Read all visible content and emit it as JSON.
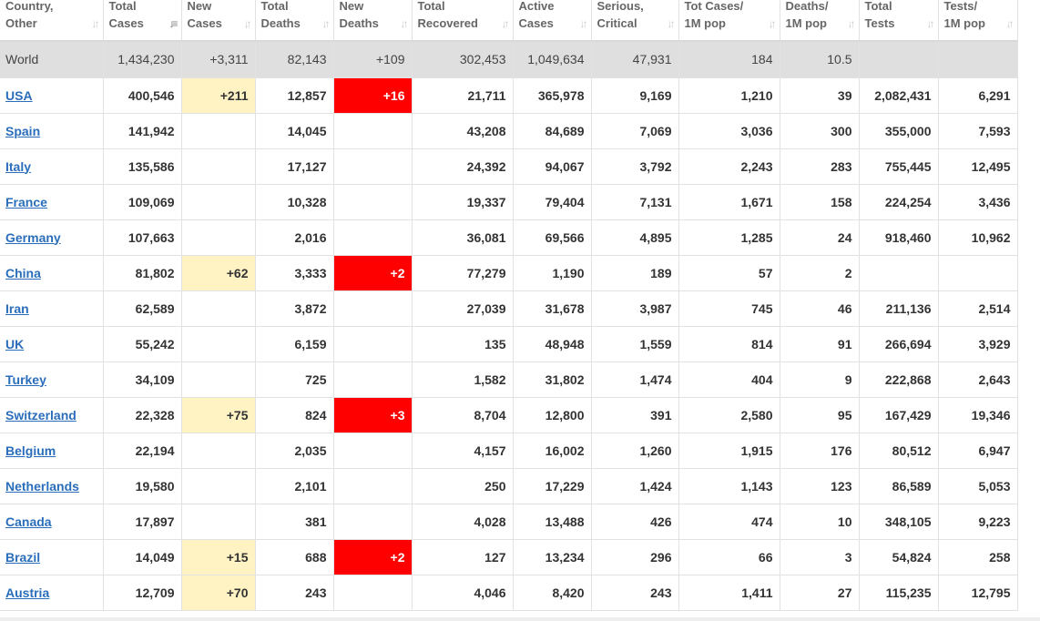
{
  "headers": [
    {
      "line1": "Country,",
      "line2": "Other",
      "sort_icon": "sort-arrows-icon"
    },
    {
      "line1": "Total",
      "line2": "Cases",
      "sort_icon": "sort-desc-icon"
    },
    {
      "line1": "New",
      "line2": "Cases",
      "sort_icon": "sort-arrows-icon"
    },
    {
      "line1": "Total",
      "line2": "Deaths",
      "sort_icon": "sort-arrows-icon"
    },
    {
      "line1": "New",
      "line2": "Deaths",
      "sort_icon": "sort-arrows-icon"
    },
    {
      "line1": "Total",
      "line2": "Recovered",
      "sort_icon": "sort-arrows-icon"
    },
    {
      "line1": "Active",
      "line2": "Cases",
      "sort_icon": "sort-arrows-icon"
    },
    {
      "line1": "Serious,",
      "line2": "Critical",
      "sort_icon": "sort-arrows-icon"
    },
    {
      "line1": "Tot Cases/",
      "line2": "1M pop",
      "sort_icon": "sort-arrows-icon"
    },
    {
      "line1": "Deaths/",
      "line2": "1M pop",
      "sort_icon": "sort-arrows-icon"
    },
    {
      "line1": "Total",
      "line2": "Tests",
      "sort_icon": "sort-arrows-icon"
    },
    {
      "line1": "Tests/",
      "line2": "1M pop",
      "sort_icon": "sort-arrows-icon"
    }
  ],
  "world": [
    "World",
    "1,434,230",
    "+3,311",
    "82,143",
    "+109",
    "302,453",
    "1,049,634",
    "47,931",
    "184",
    "10.5",
    "",
    ""
  ],
  "rows": [
    [
      "USA",
      "400,546",
      "+211",
      "12,857",
      "+16",
      "21,711",
      "365,978",
      "9,169",
      "1,210",
      "39",
      "2,082,431",
      "6,291"
    ],
    [
      "Spain",
      "141,942",
      "",
      "14,045",
      "",
      "43,208",
      "84,689",
      "7,069",
      "3,036",
      "300",
      "355,000",
      "7,593"
    ],
    [
      "Italy",
      "135,586",
      "",
      "17,127",
      "",
      "24,392",
      "94,067",
      "3,792",
      "2,243",
      "283",
      "755,445",
      "12,495"
    ],
    [
      "France",
      "109,069",
      "",
      "10,328",
      "",
      "19,337",
      "79,404",
      "7,131",
      "1,671",
      "158",
      "224,254",
      "3,436"
    ],
    [
      "Germany",
      "107,663",
      "",
      "2,016",
      "",
      "36,081",
      "69,566",
      "4,895",
      "1,285",
      "24",
      "918,460",
      "10,962"
    ],
    [
      "China",
      "81,802",
      "+62",
      "3,333",
      "+2",
      "77,279",
      "1,190",
      "189",
      "57",
      "2",
      "",
      ""
    ],
    [
      "Iran",
      "62,589",
      "",
      "3,872",
      "",
      "27,039",
      "31,678",
      "3,987",
      "745",
      "46",
      "211,136",
      "2,514"
    ],
    [
      "UK",
      "55,242",
      "",
      "6,159",
      "",
      "135",
      "48,948",
      "1,559",
      "814",
      "91",
      "266,694",
      "3,929"
    ],
    [
      "Turkey",
      "34,109",
      "",
      "725",
      "",
      "1,582",
      "31,802",
      "1,474",
      "404",
      "9",
      "222,868",
      "2,643"
    ],
    [
      "Switzerland",
      "22,328",
      "+75",
      "824",
      "+3",
      "8,704",
      "12,800",
      "391",
      "2,580",
      "95",
      "167,429",
      "19,346"
    ],
    [
      "Belgium",
      "22,194",
      "",
      "2,035",
      "",
      "4,157",
      "16,002",
      "1,260",
      "1,915",
      "176",
      "80,512",
      "6,947"
    ],
    [
      "Netherlands",
      "19,580",
      "",
      "2,101",
      "",
      "250",
      "17,229",
      "1,424",
      "1,143",
      "123",
      "86,589",
      "5,053"
    ],
    [
      "Canada",
      "17,897",
      "",
      "381",
      "",
      "4,028",
      "13,488",
      "426",
      "474",
      "10",
      "348,105",
      "9,223"
    ],
    [
      "Brazil",
      "14,049",
      "+15",
      "688",
      "+2",
      "127",
      "13,234",
      "296",
      "66",
      "3",
      "54,824",
      "258"
    ],
    [
      "Austria",
      "12,709",
      "+70",
      "243",
      "",
      "4,046",
      "8,420",
      "243",
      "1,411",
      "27",
      "115,235",
      "12,795"
    ]
  ],
  "colors": {
    "new_cases_highlight": "#fff3c4",
    "new_deaths_highlight": "#ff0000",
    "link": "#2a6ebb",
    "world_row": "#dfdfdf"
  }
}
